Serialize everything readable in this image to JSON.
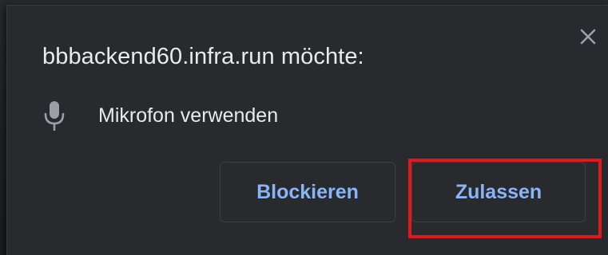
{
  "dialog": {
    "title": "bbbackend60.infra.run möchte:",
    "close_icon": "close-icon",
    "permission": {
      "icon": "microphone-icon",
      "label": "Mikrofon verwenden"
    },
    "buttons": {
      "block_label": "Blockieren",
      "allow_label": "Zulassen"
    }
  },
  "colors": {
    "dialog_background": "#292a2d",
    "text": "#e8eaed",
    "button_text": "#8ab4f8",
    "icon": "#9aa0a6",
    "highlight": "#e3171c"
  }
}
